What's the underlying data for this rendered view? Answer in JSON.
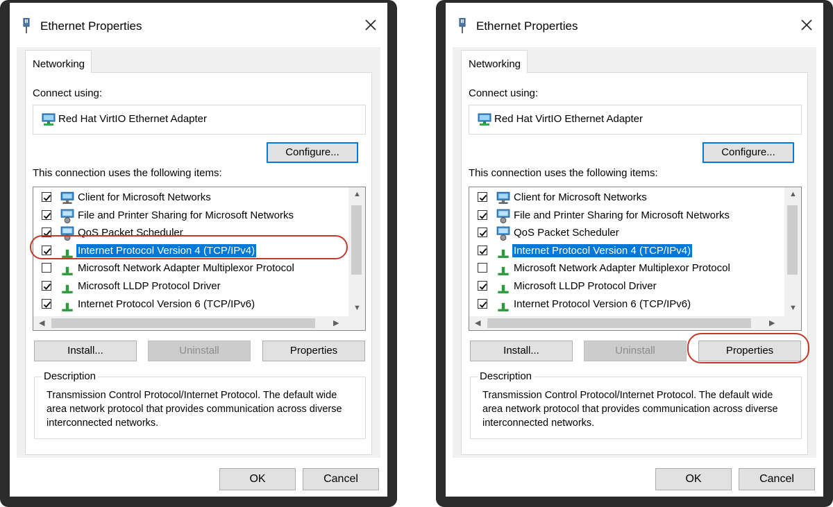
{
  "dialog": {
    "title": "Ethernet Properties",
    "tab": "Networking",
    "connect_label": "Connect using:",
    "adapter": "Red Hat VirtIO Ethernet Adapter",
    "configure": "Configure...",
    "items_label": "This connection uses the following items:",
    "items": [
      {
        "label": "Client for Microsoft Networks",
        "checked": true,
        "icon": "network-client-icon"
      },
      {
        "label": "File and Printer Sharing for Microsoft Networks",
        "checked": true,
        "icon": "network-service-icon"
      },
      {
        "label": "QoS Packet Scheduler",
        "checked": true,
        "icon": "network-service-icon"
      },
      {
        "label": "Internet Protocol Version 4 (TCP/IPv4)",
        "checked": true,
        "icon": "protocol-icon",
        "selected": true
      },
      {
        "label": "Microsoft Network Adapter Multiplexor Protocol",
        "checked": false,
        "icon": "protocol-icon"
      },
      {
        "label": "Microsoft LLDP Protocol Driver",
        "checked": true,
        "icon": "protocol-icon"
      },
      {
        "label": "Internet Protocol Version 6 (TCP/IPv6)",
        "checked": true,
        "icon": "protocol-icon"
      }
    ],
    "install": "Install...",
    "uninstall": "Uninstall",
    "properties": "Properties",
    "description_label": "Description",
    "description": "Transmission Control Protocol/Internet Protocol. The default wide area network protocol that provides communication across diverse interconnected networks.",
    "ok": "OK",
    "cancel": "Cancel"
  },
  "colors": {
    "selection": "#0078d7",
    "highlight_ring": "#c0392b",
    "frame": "#2b2b2b"
  }
}
